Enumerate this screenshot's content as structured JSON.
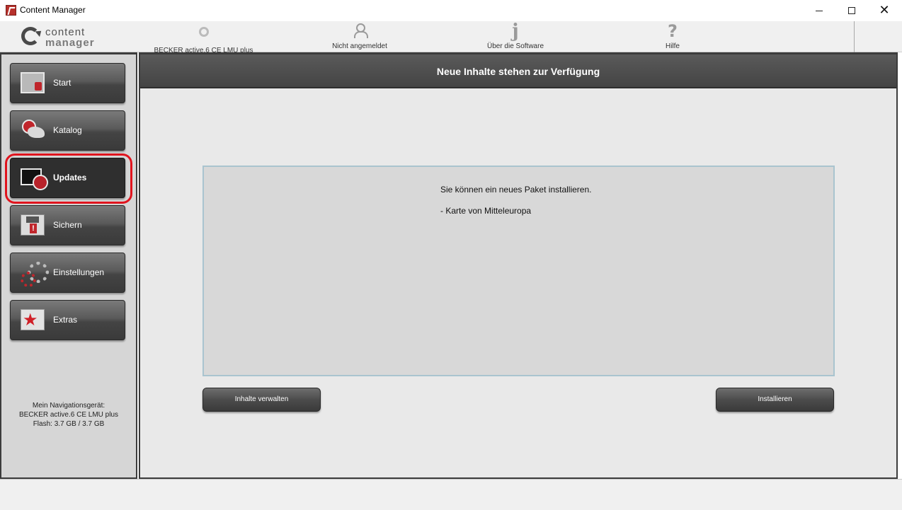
{
  "window": {
    "title": "Content Manager"
  },
  "logo": {
    "line1": "content",
    "line2": "manager"
  },
  "topnav": {
    "device_label": "BECKER active.6 CE LMU plus",
    "user_label": "Nicht angemeldet",
    "about_label": "Über die Software",
    "help_label": "Hilfe"
  },
  "sidebar": {
    "items": [
      {
        "label": "Start",
        "icon": "start-icon"
      },
      {
        "label": "Katalog",
        "icon": "catalog-icon"
      },
      {
        "label": "Updates",
        "icon": "updates-icon",
        "active": true
      },
      {
        "label": "Sichern",
        "icon": "save-disk-icon"
      },
      {
        "label": "Einstellungen",
        "icon": "gears-icon"
      },
      {
        "label": "Extras",
        "icon": "star-icon"
      }
    ],
    "device_info": {
      "line1": "Mein Navigationsgerät:",
      "line2": "BECKER active.6 CE LMU plus",
      "line3": "Flash: 3.7 GB / 3.7 GB"
    }
  },
  "main": {
    "header": "Neue Inhalte stehen zur Verfügung",
    "message": "Sie können ein neues Paket installieren.",
    "package_item": "-  Karte von Mitteleuropa",
    "manage_button": "Inhalte verwalten",
    "install_button": "Installieren"
  },
  "colors": {
    "highlight": "#e0141e",
    "button_dark": "#444444",
    "accent_red": "#c0262c"
  }
}
